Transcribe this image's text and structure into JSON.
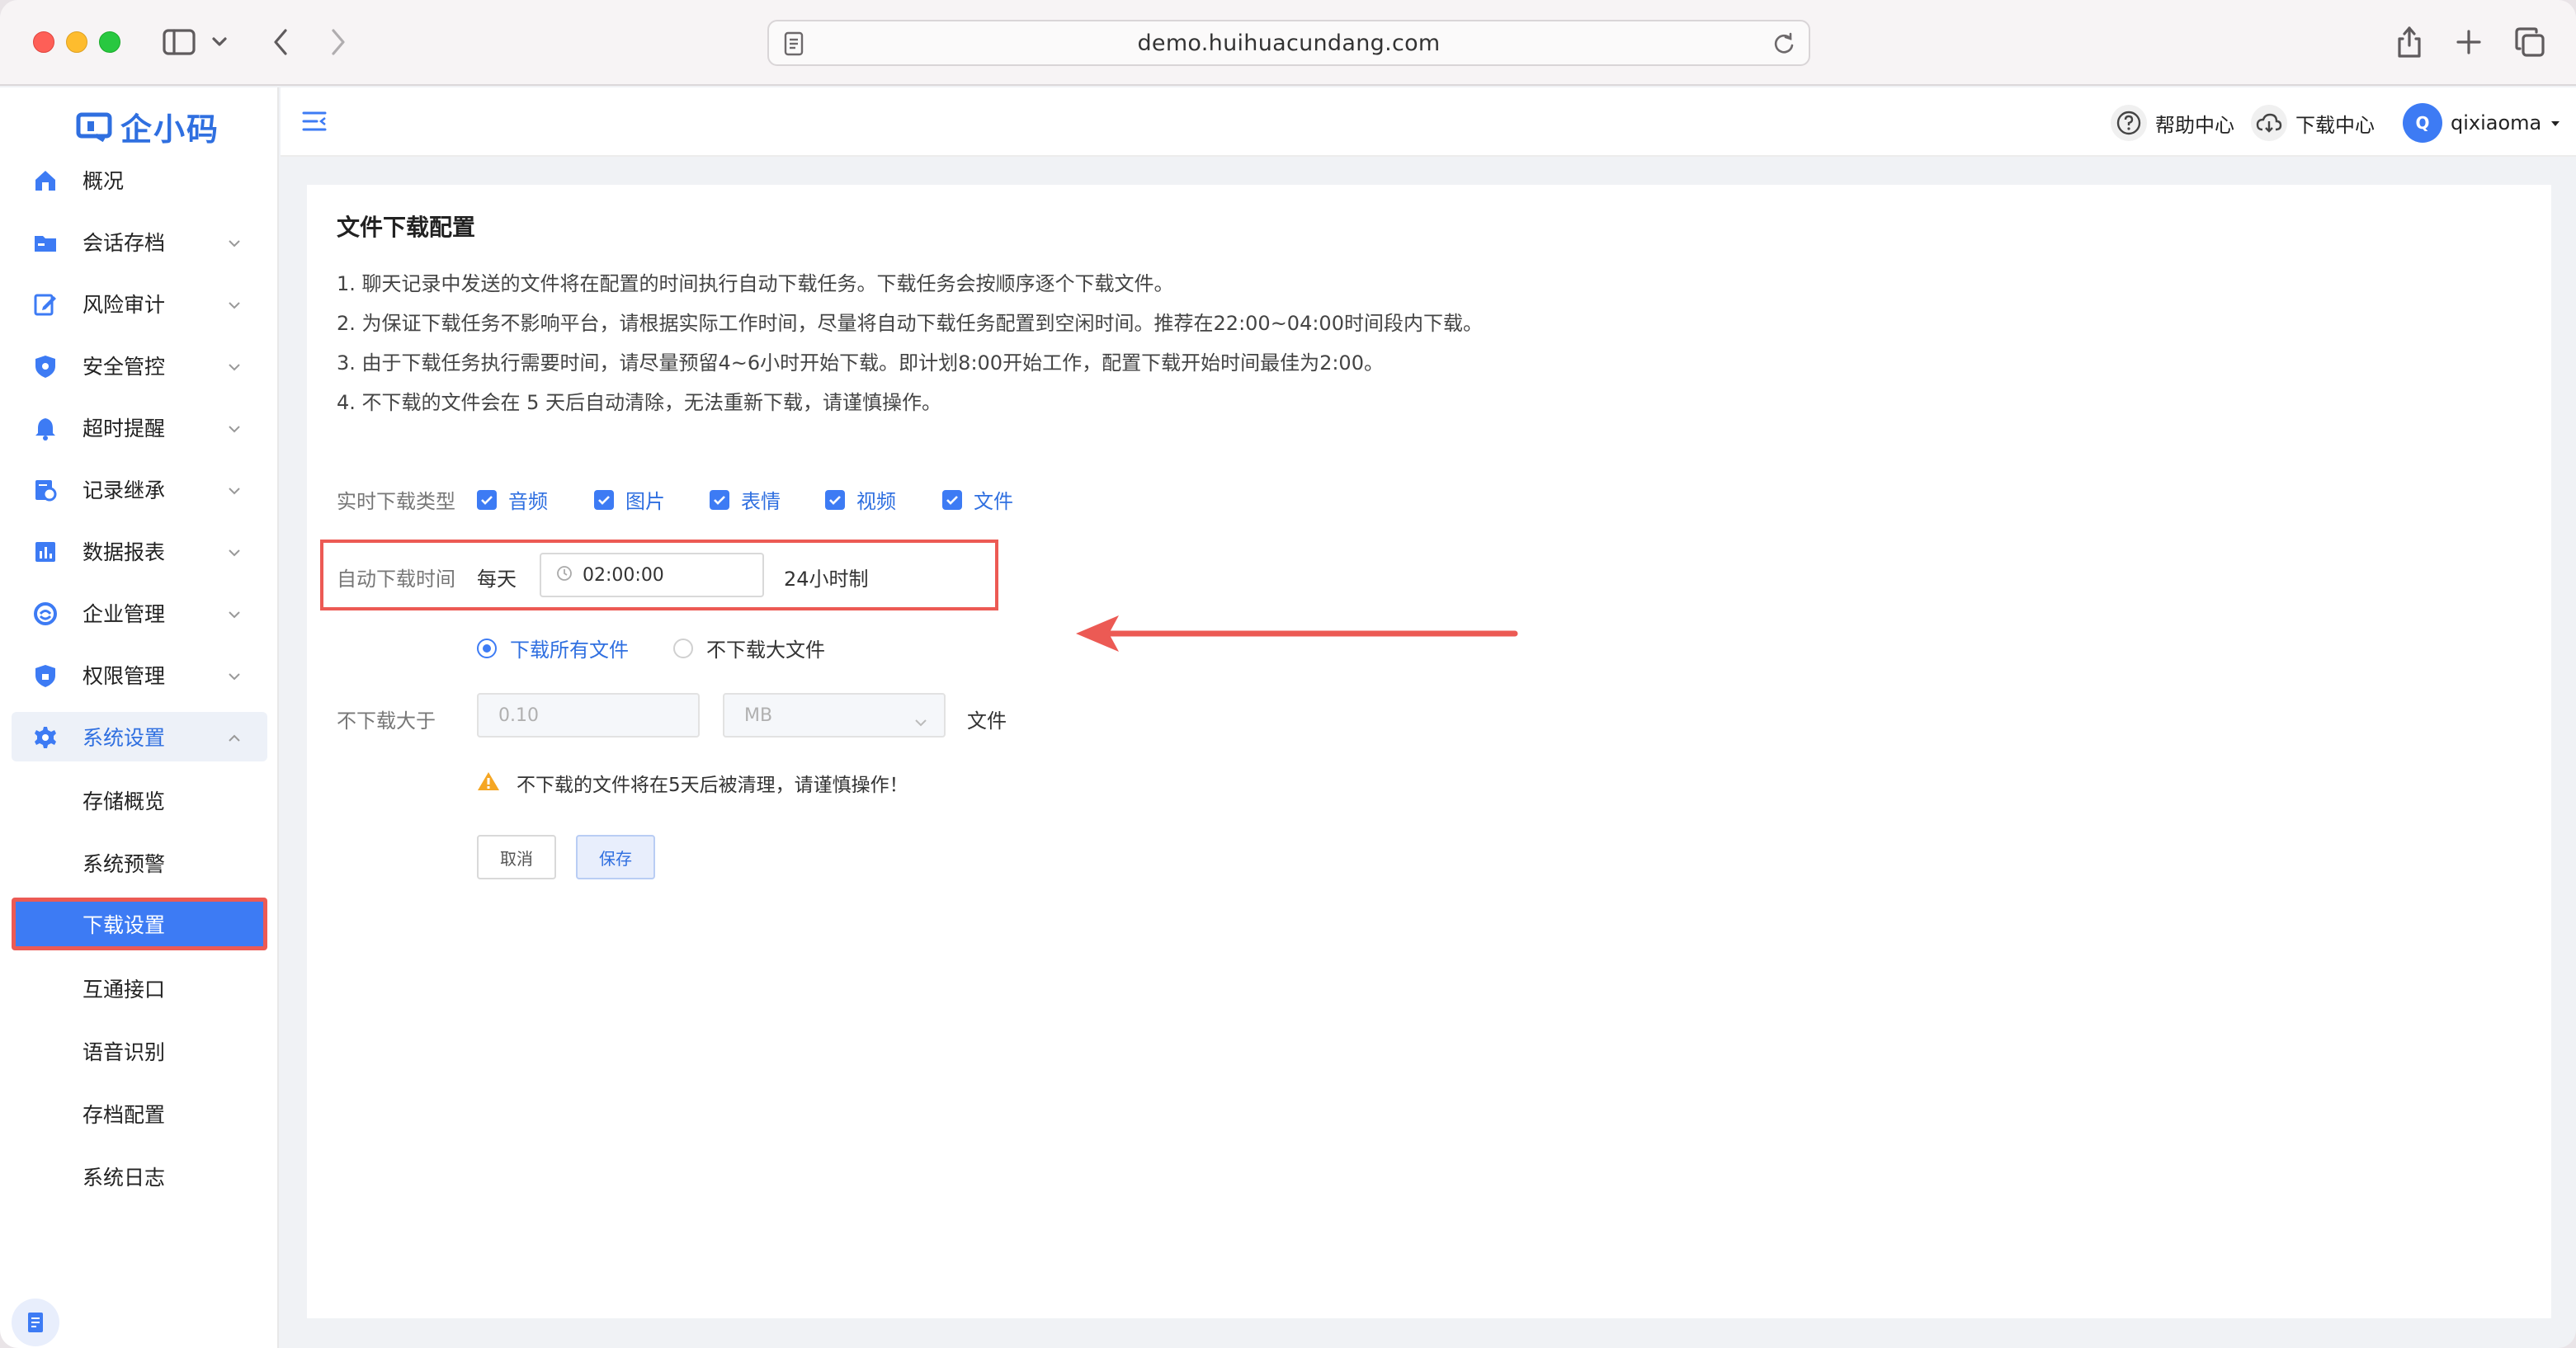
{
  "browser": {
    "url": "demo.huihuacundang.com"
  },
  "sidebar": {
    "logo_text": "企小码",
    "menu": [
      {
        "label": "概况",
        "icon": "home-icon",
        "expandable": false
      },
      {
        "label": "会话存档",
        "icon": "folder-icon",
        "expandable": true
      },
      {
        "label": "风险审计",
        "icon": "edit-icon",
        "expandable": true
      },
      {
        "label": "安全管控",
        "icon": "shield-icon",
        "expandable": true
      },
      {
        "label": "超时提醒",
        "icon": "bell-icon",
        "expandable": true
      },
      {
        "label": "记录继承",
        "icon": "record-icon",
        "expandable": true
      },
      {
        "label": "数据报表",
        "icon": "chart-icon",
        "expandable": true
      },
      {
        "label": "企业管理",
        "icon": "sync-icon",
        "expandable": true
      },
      {
        "label": "权限管理",
        "icon": "lock-shield-icon",
        "expandable": true
      },
      {
        "label": "系统设置",
        "icon": "gear-icon",
        "expandable": true,
        "open": true
      }
    ],
    "submenu": [
      {
        "label": "存储概览"
      },
      {
        "label": "系统预警"
      },
      {
        "label": "下载设置",
        "active": true
      },
      {
        "label": "互通接口"
      },
      {
        "label": "语音识别"
      },
      {
        "label": "存档配置"
      },
      {
        "label": "系统日志"
      }
    ]
  },
  "header": {
    "help_label": "帮助中心",
    "download_label": "下载中心",
    "avatar_letter": "Q",
    "username": "qixiaoma"
  },
  "main": {
    "title": "文件下载配置",
    "notes": [
      "1. 聊天记录中发送的文件将在配置的时间执行自动下载任务。下载任务会按顺序逐个下载文件。",
      "2. 为保证下载任务不影响平台，请根据实际工作时间，尽量将自动下载任务配置到空闲时间。推荐在22:00~04:00时间段内下载。",
      "3. 由于下载任务执行需要时间，请尽量预留4~6小时开始下载。即计划8:00开始工作，配置下载开始时间最佳为2:00。",
      "4. 不下载的文件会在 5 天后自动清除，无法重新下载，请谨慎操作。"
    ],
    "realtime_label": "实时下载类型",
    "types": [
      {
        "label": "音频",
        "checked": true
      },
      {
        "label": "图片",
        "checked": true
      },
      {
        "label": "表情",
        "checked": true
      },
      {
        "label": "视频",
        "checked": true
      },
      {
        "label": "文件",
        "checked": true
      }
    ],
    "auto_label": "自动下载时间",
    "auto_freq": "每天",
    "auto_time": "02:00:00",
    "auto_suffix": "24小时制",
    "radio_all": "下载所有文件",
    "radio_large": "不下载大文件",
    "radio_selected": "下载所有文件",
    "limit_label": "不下载大于",
    "limit_value": "0.10",
    "limit_unit": "MB",
    "limit_suffix": "文件",
    "warning": "不下载的文件将在5天后被清理，请谨慎操作！",
    "cancel_label": "取消",
    "save_label": "保存"
  },
  "colors": {
    "accent": "#3d7bf4",
    "annotation_red": "#ec5a54",
    "warning": "#f5a623"
  }
}
